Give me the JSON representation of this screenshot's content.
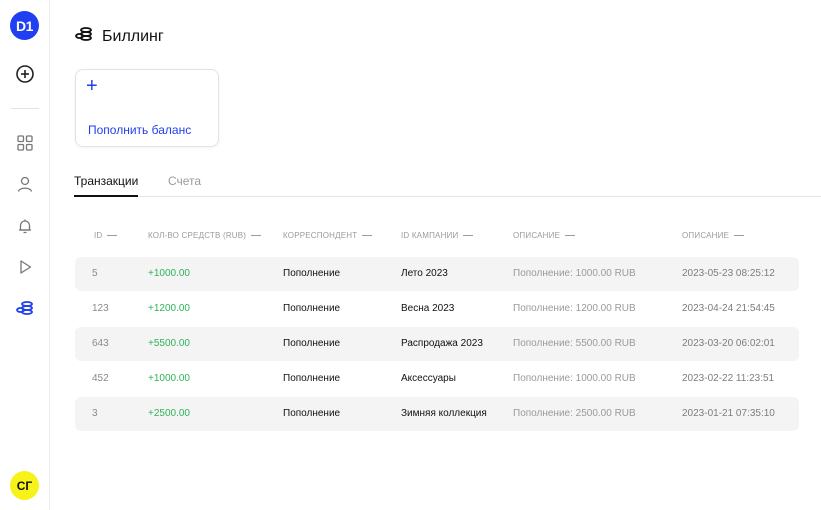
{
  "sidebar": {
    "logo_text": "D1",
    "avatar_initials": "СГ",
    "items": [
      {
        "icon": "plus-circle-icon"
      },
      {
        "icon": "grid-icon"
      },
      {
        "icon": "user-icon"
      },
      {
        "icon": "bell-icon"
      },
      {
        "icon": "play-icon"
      },
      {
        "icon": "coins-icon",
        "active": true
      }
    ],
    "accent_color": "#1f3ff0"
  },
  "header": {
    "icon": "coins-icon",
    "title": "Биллинг"
  },
  "topup_card": {
    "plus": "+",
    "label": "Пополнить баланс"
  },
  "tabs": [
    {
      "label": "Транзакции",
      "active": true
    },
    {
      "label": "Счета",
      "active": false
    }
  ],
  "table": {
    "columns": [
      "ID",
      "КОЛ-ВО СРЕДСТВ (RUB)",
      "КОРРЕСПОНДЕНТ",
      "ID КАМПАНИИ",
      "ОПИСАНИЕ",
      "ОПИСАНИЕ"
    ],
    "rows": [
      {
        "id": "5",
        "amount": "+1000.00",
        "correspondent": "Пополнение",
        "campaign": "Лето 2023",
        "description": "Пополнение: 1000.00 RUB",
        "date": "2023-05-23 08:25:12"
      },
      {
        "id": "123",
        "amount": "+1200.00",
        "correspondent": "Пополнение",
        "campaign": "Весна 2023",
        "description": "Пополнение: 1200.00 RUB",
        "date": "2023-04-24 21:54:45"
      },
      {
        "id": "643",
        "amount": "+5500.00",
        "correspondent": "Пополнение",
        "campaign": "Распродажа 2023",
        "description": "Пополнение: 5500.00 RUB",
        "date": "2023-03-20 06:02:01"
      },
      {
        "id": "452",
        "amount": "+1000.00",
        "correspondent": "Пополнение",
        "campaign": "Аксессуары",
        "description": "Пополнение: 1000.00 RUB",
        "date": "2023-02-22 11:23:51"
      },
      {
        "id": "3",
        "amount": "+2500.00",
        "correspondent": "Пополнение",
        "campaign": "Зимняя коллекция",
        "description": "Пополнение: 2500.00 RUB",
        "date": "2023-01-21 07:35:10"
      }
    ],
    "amount_color": "#2fb35a"
  }
}
